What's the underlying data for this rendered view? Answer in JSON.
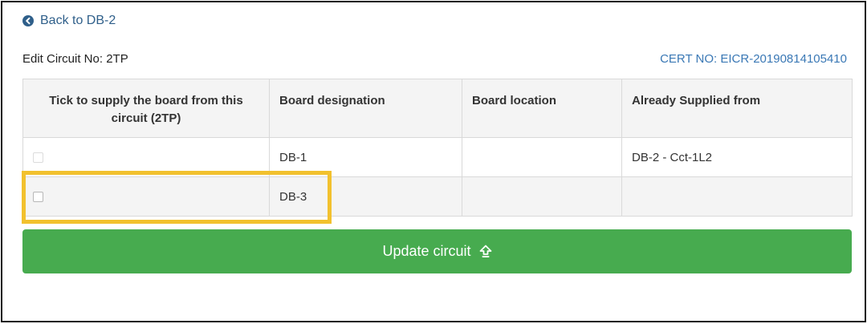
{
  "nav": {
    "back_icon": "circle-arrow-left-icon",
    "back_label": "Back to DB-2"
  },
  "header": {
    "edit_title": "Edit Circuit No: 2TP",
    "cert_no": "CERT NO: EICR-20190814105410"
  },
  "table": {
    "headers": [
      "Tick to supply the board from this circuit (2TP)",
      "Board designation",
      "Board location",
      "Already Supplied from"
    ],
    "rows": [
      {
        "checked": false,
        "disabled": true,
        "designation": "DB-1",
        "location": "",
        "supplied_from": "DB-2 - Cct-1L2"
      },
      {
        "checked": false,
        "disabled": false,
        "designation": "DB-3",
        "location": "",
        "supplied_from": ""
      }
    ]
  },
  "actions": {
    "update_label": "Update circuit",
    "update_icon": "upload-arrow-icon"
  },
  "colors": {
    "link": "#2f5f8a",
    "cert": "#3a78b5",
    "button": "#47ab4f",
    "highlight": "#f2c12e"
  }
}
